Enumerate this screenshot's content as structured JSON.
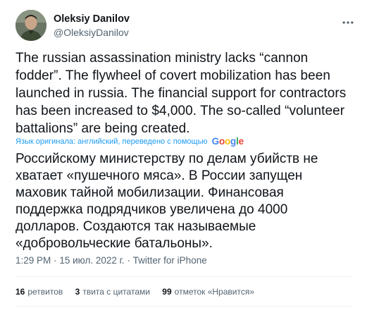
{
  "author": {
    "display_name": "Oleksiy Danilov",
    "handle": "@OleksiyDanilov"
  },
  "tweet": {
    "text": "The russian assassination ministry lacks “cannon fodder”. The flywheel of covert mobilization has been launched in russia. The financial support for contractors has been increased to $4,000. The so-called “volunteer battalions” are being created.",
    "translation_label": "Язык оригинала: английский, переведено с помощью",
    "translation_provider": "Google",
    "translated_text": "Российскому министерству по делам убийств не хватает «пушечного мяса». В России запущен маховик тайной мобилизации. Финансовая поддержка подрядчиков увеличена до 4000 долларов. Создаются так называемые «добровольческие батальоны».",
    "time": "1:29 PM",
    "date": "15 июл. 2022 г.",
    "source": "Twitter for iPhone",
    "separator": "·"
  },
  "stats": {
    "retweets_count": "16",
    "retweets_label": "ретвитов",
    "quotes_count": "3",
    "quotes_label": "твита с цитатами",
    "likes_count": "99",
    "likes_label": "отметок «Нравится»"
  },
  "colors": {
    "accent": "#1d9bf0",
    "text": "#0f1419",
    "secondary": "#536471",
    "google_blue": "#4285F4",
    "google_red": "#EA4335",
    "google_yellow": "#FBBC05",
    "google_green": "#34A853"
  },
  "icons": {
    "more": "more-horizontal-icon",
    "avatar": "avatar"
  }
}
